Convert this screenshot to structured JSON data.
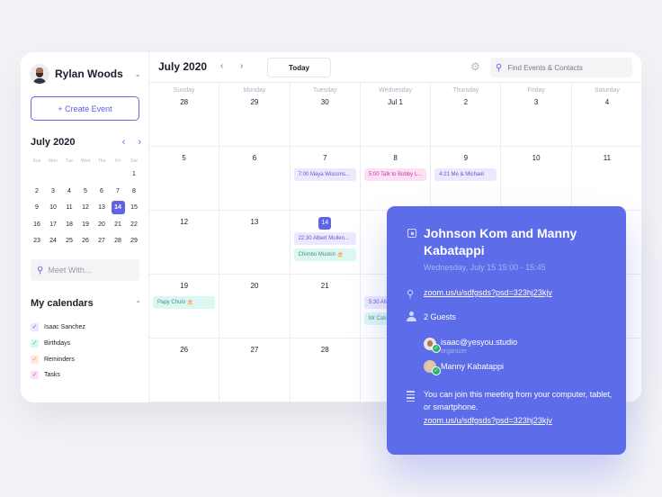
{
  "sidebar": {
    "user_name": "Rylan Woods",
    "create_label": "+ Create Event",
    "mini_calendar": {
      "title": "July 2020",
      "weekdays": [
        "Sun",
        "Mon",
        "Tue",
        "Wed",
        "Thu",
        "Fri",
        "Sat"
      ],
      "days": [
        "",
        "",
        "",
        "",
        "",
        "",
        "1",
        "2",
        "3",
        "4",
        "5",
        "6",
        "7",
        "8",
        "9",
        "10",
        "11",
        "12",
        "13",
        "14",
        "15",
        "16",
        "17",
        "18",
        "19",
        "20",
        "21",
        "22",
        "23",
        "24",
        "25",
        "26",
        "27",
        "28",
        "29"
      ],
      "selected": "14"
    },
    "meet_placeholder": "Meet With...",
    "my_calendars_title": "My calendars",
    "calendars": [
      {
        "label": "Isaac Sanchez",
        "color": "#7a5ee0",
        "bg": "#ebe7fd"
      },
      {
        "label": "Birthdays",
        "color": "#3eb5a5",
        "bg": "#dcf6f2"
      },
      {
        "label": "Reminders",
        "color": "#f29a5b",
        "bg": "#fde8d9"
      },
      {
        "label": "Tasks",
        "color": "#d94fc1",
        "bg": "#fbe0f5"
      }
    ]
  },
  "header": {
    "month_title": "July 2020",
    "prev": "‹",
    "next": "›",
    "today_label": "Today",
    "search_placeholder": "Find Events & Contacts"
  },
  "calendar": {
    "weekdays": [
      "Sunday",
      "Monday",
      "Tuesday",
      "Wednesday",
      "Thursday",
      "Friday",
      "Saturday"
    ],
    "today": "14",
    "cells": [
      {
        "num": "28",
        "events": []
      },
      {
        "num": "29",
        "events": []
      },
      {
        "num": "30",
        "events": []
      },
      {
        "num": "Jul 1",
        "events": []
      },
      {
        "num": "2",
        "events": []
      },
      {
        "num": "3",
        "events": []
      },
      {
        "num": "4",
        "events": []
      },
      {
        "num": "5",
        "events": []
      },
      {
        "num": "6",
        "events": []
      },
      {
        "num": "7",
        "events": [
          {
            "text": "7:00 Maya Wiscons...",
            "color": "purple"
          }
        ]
      },
      {
        "num": "8",
        "events": [
          {
            "text": "5:00 Talk to Bobby L...",
            "color": "pink"
          }
        ]
      },
      {
        "num": "9",
        "events": [
          {
            "text": "4:21 Me & Michael",
            "color": "purple"
          }
        ]
      },
      {
        "num": "10",
        "events": []
      },
      {
        "num": "11",
        "events": []
      },
      {
        "num": "12",
        "events": []
      },
      {
        "num": "13",
        "events": []
      },
      {
        "num": "14",
        "events": [
          {
            "text": "22:30 Albert Mullen...",
            "color": "purple"
          },
          {
            "text": "Chimbo Muskin 🎂",
            "color": "teal"
          }
        ]
      },
      {
        "num": "",
        "events": []
      },
      {
        "num": "",
        "events": []
      },
      {
        "num": "",
        "events": []
      },
      {
        "num": "",
        "events": []
      },
      {
        "num": "19",
        "events": [
          {
            "text": "Papy Chulo 🎂",
            "color": "teal"
          }
        ]
      },
      {
        "num": "20",
        "events": []
      },
      {
        "num": "21",
        "events": []
      },
      {
        "num": "",
        "events": [
          {
            "text": "5:30 AM",
            "color": "purple"
          },
          {
            "text": "Mr Cab",
            "color": "teal"
          }
        ]
      },
      {
        "num": "",
        "events": []
      },
      {
        "num": "",
        "events": []
      },
      {
        "num": "",
        "events": []
      },
      {
        "num": "26",
        "events": []
      },
      {
        "num": "27",
        "events": []
      },
      {
        "num": "28",
        "events": []
      },
      {
        "num": "",
        "events": []
      },
      {
        "num": "",
        "events": []
      },
      {
        "num": "",
        "events": []
      },
      {
        "num": "",
        "events": []
      }
    ]
  },
  "popover": {
    "title": "Johnson Kom and Manny Kabatappi",
    "datetime": "Wednesday, July 15  15:00 - 15:45",
    "link": "zoom.us/u/sdfgsds?psd=323hj23kjv",
    "guests_label": "2 Guests",
    "guests": [
      {
        "name": "isaac@yesyou.studio",
        "role": "organizer"
      },
      {
        "name": "Manny Kabatappi",
        "role": ""
      }
    ],
    "description": "You can join this meeting from your computer, tablet, or smartphone.",
    "description_link": "zoom.us/u/sdfgsds?psd=323hj23kjv"
  },
  "colors": {
    "accent": "#5f63e6",
    "popover_bg": "#5d6ce8"
  }
}
